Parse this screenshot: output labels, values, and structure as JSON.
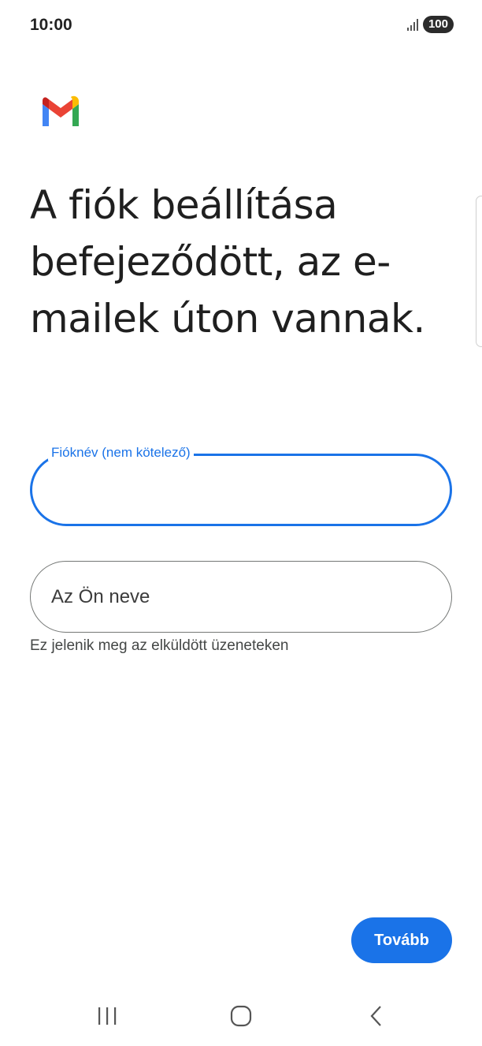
{
  "status_bar": {
    "time": "10:00",
    "battery": "100",
    "icons": [
      "signal-icon",
      "battery-icon"
    ]
  },
  "app": {
    "logo_icon": "gmail-logo-icon",
    "colors": {
      "accent": "#1a73e8",
      "gmail_red": "#ea4335",
      "gmail_blue": "#4285f4",
      "gmail_green": "#34a853",
      "gmail_yellow": "#fbbc04"
    }
  },
  "main": {
    "title": "A fiók beállítása befejeződött, az e-mailek úton vannak.",
    "account_name_field": {
      "label": "Fióknév (nem kötelező)",
      "value": ""
    },
    "your_name_field": {
      "placeholder": "Az Ön neve",
      "value": "",
      "helper": "Ez jelenik meg az elküldött üzeneteken"
    },
    "next_button_label": "Tovább"
  },
  "nav_bar": {
    "icons": [
      "recents-icon",
      "home-icon",
      "back-icon"
    ]
  }
}
